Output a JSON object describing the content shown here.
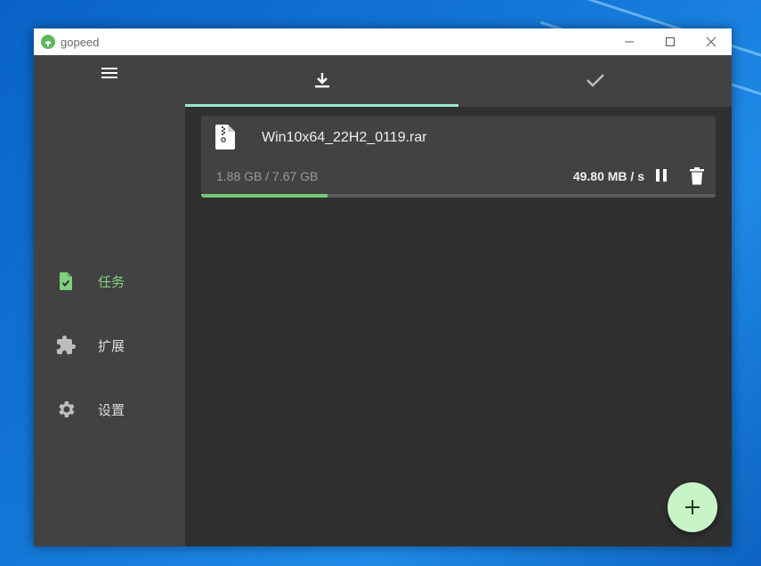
{
  "window": {
    "title": "gopeed"
  },
  "sidebar": {
    "menu_icon": "menu-icon",
    "items": [
      {
        "label": "任务",
        "icon": "task-check-icon",
        "active": true
      },
      {
        "label": "扩展",
        "icon": "puzzle-icon",
        "active": false
      },
      {
        "label": "设置",
        "icon": "gear-icon",
        "active": false
      }
    ]
  },
  "tabs": [
    {
      "icon": "download-icon",
      "selected": true
    },
    {
      "icon": "checkmark-icon",
      "selected": false
    }
  ],
  "task": {
    "file_name": "Win10x64_22H2_0119.rar",
    "progress_text": "1.88 GB / 7.67 GB",
    "speed": "49.80 MB / s",
    "progress": 0.245,
    "file_icon": "zip-file-icon"
  },
  "fab": {
    "icon": "plus-icon"
  },
  "colors": {
    "accent_green": "#7ed07e",
    "tab_indicator": "#9ee8cf",
    "fab_bg": "#c8f5c8",
    "sidebar_bg": "#424242",
    "main_bg": "#303030"
  }
}
